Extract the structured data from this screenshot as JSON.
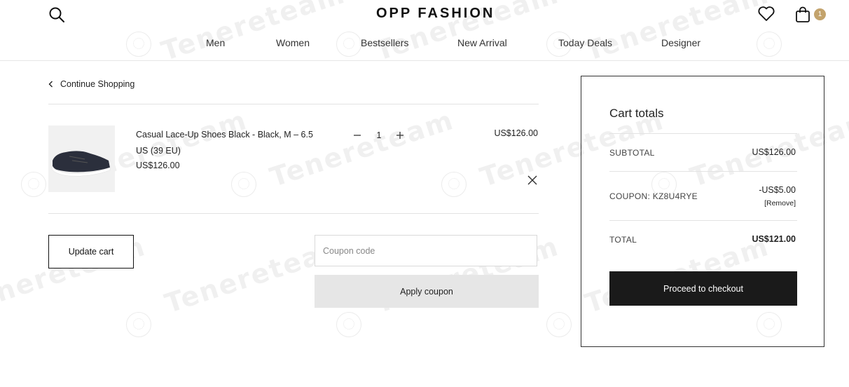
{
  "header": {
    "brand": "OPP FASHION",
    "cart_count": "1",
    "nav": [
      "Men",
      "Women",
      "Bestsellers",
      "New Arrival",
      "Today Deals",
      "Designer"
    ]
  },
  "page": {
    "continue_label": "Continue Shopping"
  },
  "cart": {
    "items": [
      {
        "name": "Casual Lace-Up Shoes Black - Black, M – 6.5 US (39 EU)",
        "price": "US$126.00",
        "qty": "1",
        "line_total": "US$126.00"
      }
    ],
    "update_label": "Update cart",
    "coupon_placeholder": "Coupon code",
    "apply_label": "Apply coupon"
  },
  "totals": {
    "title": "Cart totals",
    "subtotal_label": "SUBTOTAL",
    "subtotal_value": "US$126.00",
    "coupon_label": "COUPON: KZ8U4RYE",
    "coupon_value": "-US$5.00",
    "coupon_remove": "[Remove]",
    "total_label": "TOTAL",
    "total_value": "US$121.00",
    "checkout_label": "Proceed to checkout"
  },
  "watermark": "Tenereteam",
  "colors": {
    "accent_badge": "#c3a36c",
    "checkout_bg": "#1a1a1a",
    "apply_bg": "#e6e6e6"
  }
}
